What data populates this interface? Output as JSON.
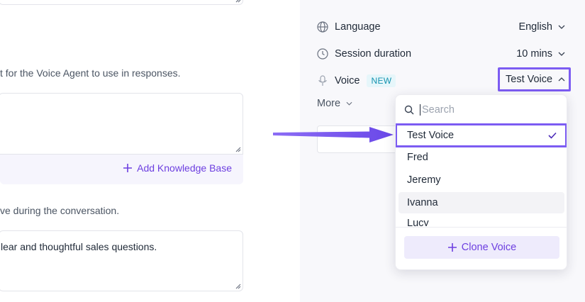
{
  "knowledge": {
    "hint": "t for the Voice Agent to use in responses.",
    "add_label": "Add Knowledge Base"
  },
  "guidelines": {
    "hint": "ve during the conversation.",
    "value": "lear and thoughtful sales questions."
  },
  "settings": {
    "language": {
      "label": "Language",
      "value": "English",
      "icon": "globe-icon"
    },
    "session": {
      "label": "Session duration",
      "value": "10 mins",
      "icon": "clock-icon"
    },
    "voice": {
      "label": "Voice",
      "badge": "NEW",
      "value": "Test Voice",
      "icon": "microphone-icon"
    },
    "more_label": "More"
  },
  "voice_dropdown": {
    "search_placeholder": "Search",
    "options": [
      {
        "label": "Test Voice",
        "selected": true
      },
      {
        "label": "Fred"
      },
      {
        "label": "Jeremy"
      },
      {
        "label": "Ivanna"
      },
      {
        "label": "Lucy"
      }
    ],
    "clone_label": "Clone Voice"
  },
  "colors": {
    "accent": "#7c5cf2",
    "accent_text": "#6d3fe0",
    "badge": "#1693b0"
  }
}
